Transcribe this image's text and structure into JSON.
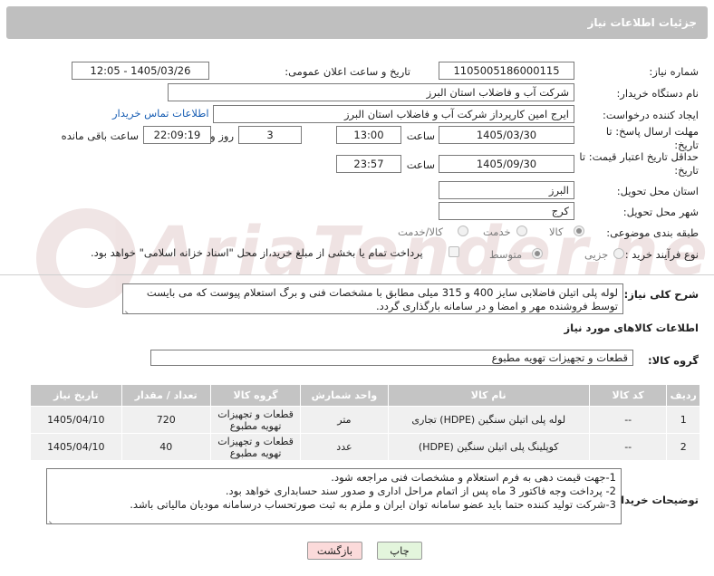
{
  "header": {
    "title": "جزئیات اطلاعات نیاز"
  },
  "watermark": {
    "text": "AriaTender.neT"
  },
  "form": {
    "need_number_label": "شماره نیاز:",
    "need_number": "1105005186000115",
    "announce_label": "تاریخ و ساعت اعلان عمومی:",
    "announce_value": "1405/03/26 - 12:05",
    "buyer_org_label": "نام دستگاه خریدار:",
    "buyer_org": "شرکت آب و فاضلاب استان البرز",
    "creator_label": "ایجاد کننده درخواست:",
    "creator": "ایرج امین کارپرداز شرکت آب و فاضلاب استان البرز",
    "contact_link": "اطلاعات تماس خریدار",
    "deadline_label": "مهلت ارسال پاسخ: تا تاریخ:",
    "deadline_date": "1405/03/30",
    "time_label": "ساعت",
    "deadline_time": "13:00",
    "days_value": "3",
    "days_label": "روز و",
    "remaining_time": "22:09:19",
    "remaining_label": "ساعت باقی مانده",
    "validity_label": "حداقل تاریخ اعتبار قیمت: تا تاریخ:",
    "validity_date": "1405/09/30",
    "validity_time": "23:57",
    "province_label": "استان محل تحویل:",
    "province": "البرز",
    "city_label": "شهر محل تحویل:",
    "city": "کرج",
    "category_label": "طبقه بندی موضوعی:",
    "category_options": [
      "کالا",
      "خدمت",
      "کالا/خدمت"
    ],
    "category_selected": "کالا",
    "process_label": "نوع فرآیند خرید :",
    "process_options": [
      "جزیی",
      "متوسط"
    ],
    "process_selected": "متوسط",
    "payment_note": "پرداخت تمام یا بخشی از مبلغ خرید،از محل \"اسناد خزانه اسلامی\" خواهد بود.",
    "description_label": "شرح کلی نیاز:",
    "description": "لوله پلی اتیلن فاضلابی سایز 400 و 315 میلی مطابق با مشخصات فنی و برگ استعلام پیوست که می بایست توسط فروشنده مهر و امضا و در سامانه بارگذاری گردد."
  },
  "goods": {
    "section_title": "اطلاعات کالاهای مورد نیاز",
    "group_label": "گروه کالا:",
    "group_value": "قطعات و تجهیزات تهویه مطبوع",
    "columns": [
      "ردیف",
      "کد کالا",
      "نام کالا",
      "واحد شمارش",
      "گروه کالا",
      "تعداد / مقدار",
      "تاریخ نیاز"
    ],
    "rows": [
      [
        "1",
        "--",
        "لوله پلی اتیلن سنگین (HDPE) تجاری",
        "متر",
        "قطعات و تجهیزات تهویه مطبوع",
        "720",
        "1405/04/10"
      ],
      [
        "2",
        "--",
        "کوپلینگ پلی اتیلن سنگین (HDPE)",
        "عدد",
        "قطعات و تجهیزات تهویه مطبوع",
        "40",
        "1405/04/10"
      ]
    ]
  },
  "buyer_notes": {
    "label": "توضیحات خریدار:",
    "lines": [
      "1-جهت قیمت دهی به فرم استعلام و مشخصات فنی مراجعه شود.",
      "2- پرداخت وجه فاکتور 3 ماه پس از اتمام مراحل اداری و صدور سند حسابداری خواهد بود.",
      "3-شرکت تولید کننده حتما باید عضو سامانه توان ایران و ملزم به ثبت صورتحساب درسامانه مودیان مالیاتی باشد."
    ]
  },
  "buttons": {
    "print": "چاپ",
    "back": "بازگشت"
  },
  "colors": {
    "header": "#bfbfbf",
    "table_header": "#c4c4c4",
    "back_button": "#fbdada",
    "print_button": "#e3f5dc"
  }
}
